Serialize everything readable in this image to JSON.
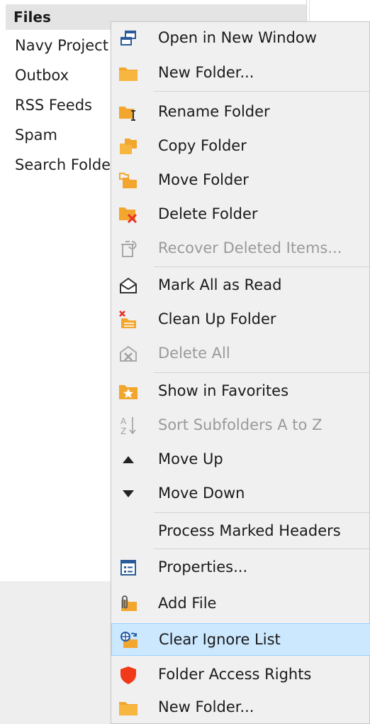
{
  "pane": {
    "header": "Files",
    "folders": [
      "Navy Project",
      "Outbox",
      "RSS Feeds",
      "Spam",
      "Search Folders"
    ]
  },
  "menu": {
    "items": [
      {
        "label": "Open in New Window",
        "icon": "open-window-icon",
        "disabled": false
      },
      {
        "label": "New Folder...",
        "icon": "new-folder-icon",
        "disabled": false
      },
      {
        "label": "Rename Folder",
        "icon": "rename-folder-icon",
        "disabled": false
      },
      {
        "label": "Copy Folder",
        "icon": "copy-folder-icon",
        "disabled": false
      },
      {
        "label": "Move Folder",
        "icon": "move-folder-icon",
        "disabled": false
      },
      {
        "label": "Delete Folder",
        "icon": "delete-folder-icon",
        "disabled": false
      },
      {
        "label": "Recover Deleted Items...",
        "icon": "recover-items-icon",
        "disabled": true
      },
      {
        "label": "Mark All as Read",
        "icon": "mark-read-icon",
        "disabled": false
      },
      {
        "label": "Clean Up Folder",
        "icon": "clean-up-icon",
        "disabled": false
      },
      {
        "label": "Delete All",
        "icon": "delete-all-icon",
        "disabled": true
      },
      {
        "label": "Show in Favorites",
        "icon": "favorites-star-icon",
        "disabled": false
      },
      {
        "label": "Sort Subfolders A to Z",
        "icon": "sort-az-icon",
        "disabled": true
      },
      {
        "label": "Move Up",
        "icon": "triangle-up-icon",
        "disabled": false
      },
      {
        "label": "Move Down",
        "icon": "triangle-down-icon",
        "disabled": false
      },
      {
        "label": "Process Marked Headers",
        "icon": "",
        "disabled": false
      },
      {
        "label": "Properties...",
        "icon": "properties-icon",
        "disabled": false
      },
      {
        "label": "Add File",
        "icon": "add-file-icon",
        "disabled": false
      },
      {
        "label": "Clear Ignore List",
        "icon": "clear-ignore-icon",
        "disabled": false,
        "highlighted": true
      },
      {
        "label": "Folder Access Rights",
        "icon": "shield-icon",
        "disabled": false
      },
      {
        "label": "New Folder...",
        "icon": "new-folder-icon",
        "disabled": false
      }
    ]
  },
  "colors": {
    "menu_bg": "#f0f0f0",
    "highlight": "#cce8ff",
    "folder_orange": "#f2a62e",
    "delete_red": "#e8302a",
    "shield_red": "#f03a1a",
    "disabled_text": "#9a9a9a"
  }
}
